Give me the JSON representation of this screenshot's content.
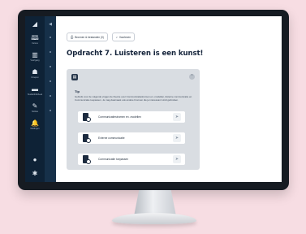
{
  "nav": {
    "items": [
      {
        "icon": "home-icon",
        "glyph": "◢",
        "label": ""
      },
      {
        "icon": "course-icon",
        "glyph": "🕮",
        "label": "Cursus"
      },
      {
        "icon": "progress-icon",
        "glyph": "▥",
        "label": "Voortgang"
      },
      {
        "icon": "groups-icon",
        "glyph": "☗",
        "label": "Groepen"
      },
      {
        "icon": "library-icon",
        "glyph": "▬",
        "label": "Studiebibliotheek"
      },
      {
        "icon": "notes-icon",
        "glyph": "✎",
        "label": "Notities"
      },
      {
        "icon": "notifications-icon",
        "glyph": "🔔",
        "label": "Meldingen"
      }
    ],
    "bottom": [
      {
        "icon": "user-icon",
        "glyph": "●",
        "label": ""
      },
      {
        "icon": "settings-icon",
        "glyph": "✱",
        "label": ""
      }
    ]
  },
  "toolbar": {
    "chip1": "Bronnen & bestanden (0)",
    "chip2": "Voorlezen"
  },
  "page_title": "Opdracht 7. Luisteren is een kunst!",
  "tip": {
    "heading": "Tip",
    "text": "Gebruik voor de volgende vragen de theorie over Communicatiestromen en -modellen, Externe communicatie en Communicatie toepassen. Je mag daarnaast ook andere bronnen die je interessant vindt gebruiken."
  },
  "resources": [
    {
      "label": "Communicatiestromen en -modellen"
    },
    {
      "label": "Externe communicatie"
    },
    {
      "label": "Communicatie toepassen"
    }
  ],
  "colors": {
    "background": "#f7dde3",
    "nav": "#0e2236",
    "panel": "#d9dde2",
    "title": "#14233a"
  }
}
